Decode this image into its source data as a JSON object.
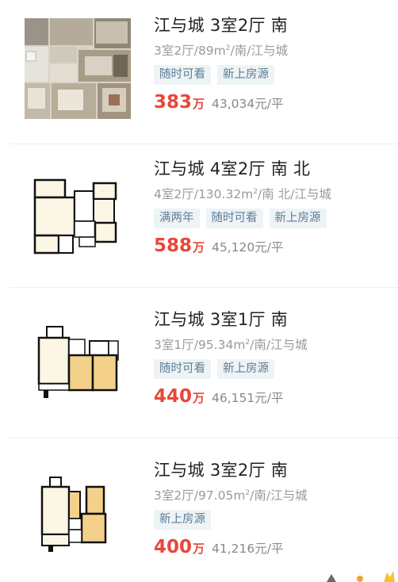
{
  "listings": [
    {
      "title": "江与城 3室2厅 南",
      "sub_main": "3室2厅/89m",
      "sub_sup": "2",
      "sub_rest": "/南/江与城",
      "tags": [
        "随时可看",
        "新上房源"
      ],
      "price": "383",
      "price_unit": "万",
      "unit_price": "43,034元/平",
      "thumb_icon": "floorplan-3d-image"
    },
    {
      "title": "江与城 4室2厅 南 北",
      "sub_main": "4室2厅/130.32m",
      "sub_sup": "2",
      "sub_rest": "/南 北/江与城",
      "tags": [
        "满两年",
        "随时可看",
        "新上房源"
      ],
      "price": "588",
      "price_unit": "万",
      "unit_price": "45,120元/平",
      "thumb_icon": "floorplan-image"
    },
    {
      "title": "江与城 3室1厅 南",
      "sub_main": "3室1厅/95.34m",
      "sub_sup": "2",
      "sub_rest": "/南/江与城",
      "tags": [
        "随时可看",
        "新上房源"
      ],
      "price": "440",
      "price_unit": "万",
      "unit_price": "46,151元/平",
      "thumb_icon": "floorplan-image"
    },
    {
      "title": "江与城 3室2厅 南",
      "sub_main": "3室2厅/97.05m",
      "sub_sup": "2",
      "sub_rest": "/南/江与城",
      "tags": [
        "新上房源"
      ],
      "price": "400",
      "price_unit": "万",
      "unit_price": "41,216元/平",
      "thumb_icon": "floorplan-image"
    }
  ],
  "colors": {
    "price": "#e8473a",
    "tag_text": "#5d7d95",
    "tag_bg": "#eef3f6",
    "title": "#222222",
    "subtitle": "#9a9a9a"
  }
}
